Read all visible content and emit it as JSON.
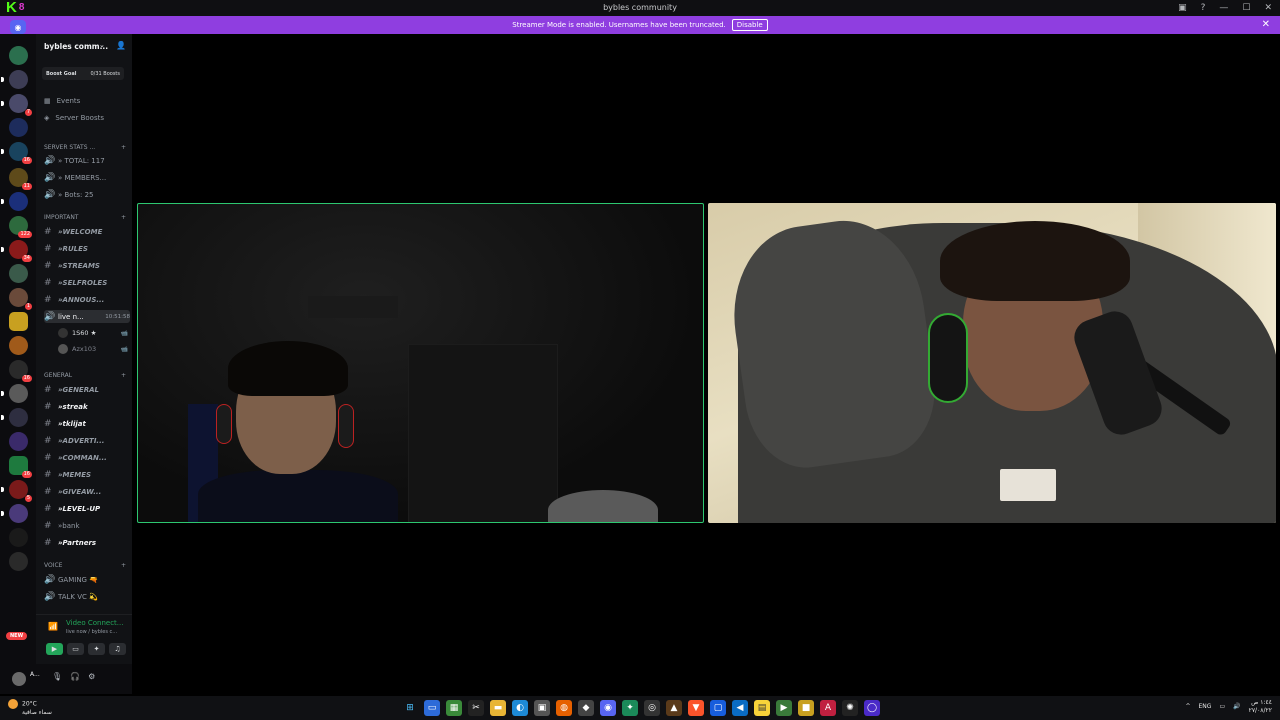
{
  "window": {
    "title": "bybles community",
    "logo_text": "K",
    "logo_badge": "8"
  },
  "streamer_bar": {
    "message": "Streamer Mode is enabled. Usernames have been truncated.",
    "disable_label": "Disable"
  },
  "sidebar": {
    "server_name": "bybles comm...",
    "boost_goal_label": "Boost Goal",
    "boost_count": "0/31 Boosts",
    "nav": [
      {
        "label": "Events",
        "icon": "calendar-icon"
      },
      {
        "label": "Server Boosts",
        "icon": "boost-icon"
      }
    ],
    "categories": {
      "server_stats": "SERVER STATS ...",
      "important": "IMPORTANT",
      "general": "GENERAL",
      "voice": "VOICE"
    },
    "stats": [
      {
        "label": "» TOTAL: 117"
      },
      {
        "label": "» MEMBERS..."
      },
      {
        "label": "» Bots: 25"
      }
    ],
    "important_channels": [
      {
        "label": "»WELCOME"
      },
      {
        "label": "»RULES"
      },
      {
        "label": "»STREAMS"
      },
      {
        "label": "»SELFROLES"
      },
      {
        "label": "»ANNOUS..."
      }
    ],
    "live_channel": {
      "label": "live n...",
      "timer": "10:51:58"
    },
    "voice_users": [
      {
        "name": "1S60 ★"
      },
      {
        "name": "Azx103"
      }
    ],
    "general_channels": [
      {
        "label": "»GENERAL"
      },
      {
        "label": "»streak"
      },
      {
        "label": "»tklijat"
      },
      {
        "label": "»ADVERTI..."
      },
      {
        "label": "»COMMAN..."
      },
      {
        "label": "»MEMES"
      },
      {
        "label": "»GIVEAW..."
      },
      {
        "label": "»LEVEL-UP"
      },
      {
        "label": "»bank"
      },
      {
        "label": "»Partners"
      }
    ],
    "voice_channels": [
      {
        "label": "GAMING 🔫"
      },
      {
        "label": "TALK VC 💫"
      }
    ]
  },
  "guild_badges": [
    "7",
    "16",
    "11",
    "122",
    "34",
    "1",
    "16",
    "16",
    "5"
  ],
  "new_badge": "NEW",
  "voice_panel": {
    "status": "Video Connect...",
    "sub": "live now / bybles c..."
  },
  "user_panel": {
    "name": "A..."
  },
  "taskbar": {
    "temp": "20°C",
    "weather": "سماء صافية",
    "lang": "ENG",
    "time": "١:٤٤ ص",
    "date": "٢٧/٠٨/٢٢"
  },
  "colors": {
    "accent_purple": "#8f3ee0",
    "speaking_green": "#2dc770",
    "kick_green": "#53fc18"
  }
}
